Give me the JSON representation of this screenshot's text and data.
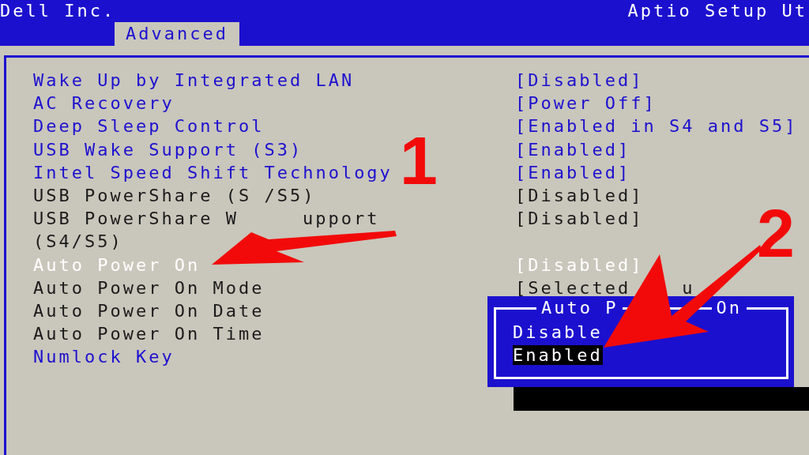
{
  "header": {
    "vendor": "Dell Inc.",
    "utility": "Aptio Setup Ut"
  },
  "tabs": [
    {
      "label": "Advanced",
      "selected": true
    }
  ],
  "settings": [
    {
      "label": [
        "Wake Up by Integrated LAN"
      ],
      "value": [
        "[Disabled]"
      ],
      "disabled": false,
      "selected": false
    },
    {
      "label": [
        "AC Recovery"
      ],
      "value": [
        "[Power Off]"
      ],
      "disabled": false,
      "selected": false
    },
    {
      "label": [
        "Deep Sleep Control"
      ],
      "value": [
        "[Enabled in S4 and S5]"
      ],
      "disabled": false,
      "selected": false
    },
    {
      "label": [
        "USB Wake Support (S3)"
      ],
      "value": [
        "[Enabled]"
      ],
      "disabled": false,
      "selected": false
    },
    {
      "label": [
        "Intel Speed Shift Technology"
      ],
      "value": [
        "[Enabled]"
      ],
      "disabled": false,
      "selected": false
    },
    {
      "label": [
        "USB PowerShare (S",
        "/S5)"
      ],
      "value": [
        "[Disabled]"
      ],
      "disabled": true,
      "selected": false
    },
    {
      "label": [
        "USB PowerShare W",
        "upport"
      ],
      "value": [
        "[Disabled]"
      ],
      "disabled": true,
      "selected": false
    },
    {
      "label": [
        "(S4/S5)"
      ],
      "disabled": true,
      "selected": false
    },
    {
      "label": [
        "Auto Power On"
      ],
      "value": [
        "[Disabled]"
      ],
      "disabled": true,
      "selected": true
    },
    {
      "label": [
        "Auto Power On Mode"
      ],
      "value": [
        "[Selected",
        "u"
      ],
      "disabled": true,
      "selected": false
    },
    {
      "label": [
        "Auto Power On Date"
      ],
      "disabled": true,
      "selected": false
    },
    {
      "label": [
        "Auto Power On Time"
      ],
      "disabled": true,
      "selected": false
    },
    {
      "label": [
        "Numlock Key"
      ],
      "disabled": false,
      "selected": false
    }
  ],
  "popup": {
    "title": [
      "Auto P",
      "On"
    ],
    "options": [
      {
        "label": "Disable",
        "selected": false
      },
      {
        "label": "Enabled",
        "selected": true
      }
    ]
  },
  "annotations": [
    {
      "number": "1"
    },
    {
      "number": "2"
    }
  ]
}
